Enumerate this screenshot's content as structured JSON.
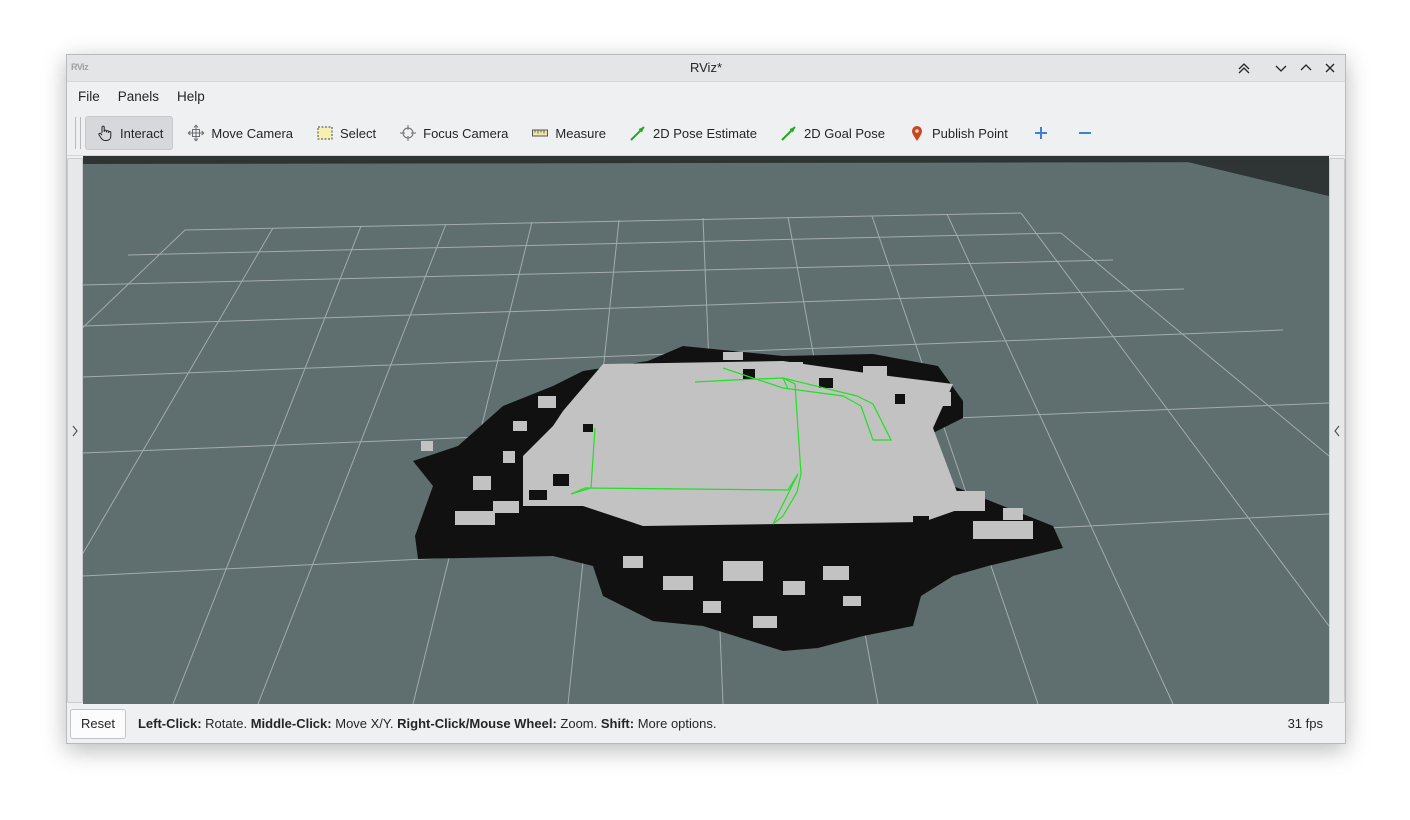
{
  "window": {
    "title": "RViz*",
    "app_icon_text": "RViz"
  },
  "menu": [
    "File",
    "Panels",
    "Help"
  ],
  "toolbar": {
    "tools": [
      {
        "label": "Interact",
        "icon": "hand-pointer-icon",
        "active": true
      },
      {
        "label": "Move Camera",
        "icon": "move-arrows-icon"
      },
      {
        "label": "Select",
        "icon": "selection-rectangle-icon"
      },
      {
        "label": "Focus Camera",
        "icon": "crosshair-icon"
      },
      {
        "label": "Measure",
        "icon": "ruler-icon"
      },
      {
        "label": "2D Pose Estimate",
        "icon": "green-arrow-icon"
      },
      {
        "label": "2D Goal Pose",
        "icon": "green-arrow-icon"
      },
      {
        "label": "Publish Point",
        "icon": "map-pin-icon"
      }
    ],
    "add_icon": "plus-icon",
    "remove_icon": "minus-icon"
  },
  "status": {
    "reset_label": "Reset",
    "hints": [
      {
        "key": "Left-Click:",
        "action": "Rotate."
      },
      {
        "key": "Middle-Click:",
        "action": "Move X/Y."
      },
      {
        "key": "Right-Click/Mouse Wheel:",
        "action": "Zoom."
      },
      {
        "key": "Shift:",
        "action": "More options."
      }
    ],
    "fps": "31 fps"
  },
  "colors": {
    "background": "#5f6e6e",
    "grid": "#a6b0b0",
    "free_cell": "#c2c2c2",
    "occupied_cell": "#111111",
    "path": "#22e022"
  }
}
